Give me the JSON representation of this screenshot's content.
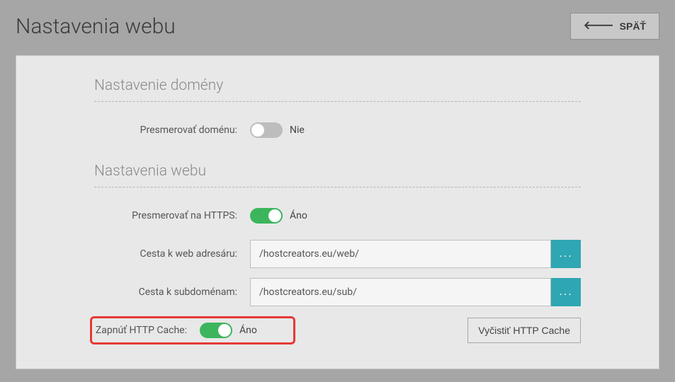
{
  "header": {
    "title": "Nastavenia webu",
    "back_label": "SPÄŤ"
  },
  "sections": {
    "domain": {
      "title": "Nastavenie domény",
      "redirect_domain_label": "Presmerovať doménu:",
      "redirect_domain_value": "Nie"
    },
    "web": {
      "title": "Nastavenia webu",
      "redirect_https_label": "Presmerovať na HTTPS:",
      "redirect_https_value": "Áno",
      "web_path_label": "Cesta k web adresáru:",
      "web_path_value": "/hostcreators.eu/web/",
      "sub_path_label": "Cesta k subdoménam:",
      "sub_path_value": "/hostcreators.eu/sub/",
      "http_cache_label": "Zapnúť HTTP Cache:",
      "http_cache_value": "Áno",
      "clear_cache_label": "Vyčistiť HTTP Cache"
    }
  },
  "icons": {
    "browse": "..."
  }
}
